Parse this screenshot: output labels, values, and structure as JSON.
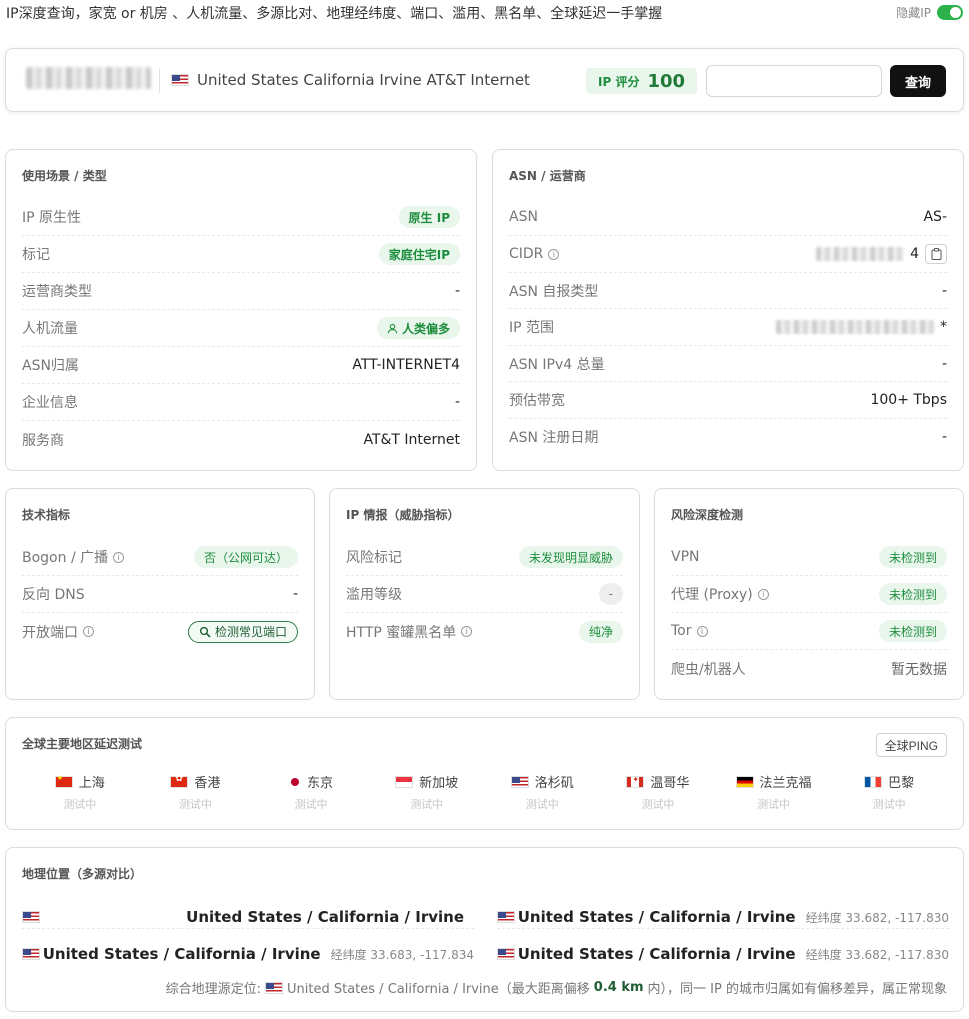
{
  "header": {
    "tagline": "IP深度查询，家宽 or 机房 、人机流量、多源比对、地理经纬度、端口、滥用、黑名单、全球延迟一手掌握",
    "hide_ip_label": "隐藏IP",
    "hide_ip_on": true
  },
  "search": {
    "location": "United States California Irvine AT&T Internet",
    "score_label": "IP 评分",
    "score_value": "100",
    "input_value": "",
    "query_button": "查询"
  },
  "usage": {
    "title": "使用场景 / 类型",
    "rows": [
      {
        "label": "IP 原生性",
        "value": "原生 IP"
      },
      {
        "label": "标记",
        "value": "家庭住宅IP"
      },
      {
        "label": "运营商类型",
        "value": "-"
      },
      {
        "label": "人机流量",
        "value": "人类偏多"
      },
      {
        "label": "ASN归属",
        "value": "ATT-INTERNET4"
      },
      {
        "label": "企业信息",
        "value": "-"
      },
      {
        "label": "服务商",
        "value": "AT&T Internet"
      }
    ]
  },
  "asn": {
    "title": "ASN / 运营商",
    "rows": [
      {
        "label": "ASN",
        "value": "AS-"
      },
      {
        "label": "CIDR",
        "value": "4"
      },
      {
        "label": "ASN 自报类型",
        "value": "-"
      },
      {
        "label": "IP 范围",
        "value": "*"
      },
      {
        "label": "ASN IPv4 总量",
        "value": "-"
      },
      {
        "label": "预估带宽",
        "value": "100+ Tbps"
      },
      {
        "label": "ASN 注册日期",
        "value": "-"
      }
    ]
  },
  "tech": {
    "title": "技术指标",
    "rows": [
      {
        "label": "Bogon / 广播",
        "value": "否（公网可达）"
      },
      {
        "label": "反向 DNS",
        "value": "-"
      },
      {
        "label": "开放端口",
        "value": "检测常见端口"
      }
    ]
  },
  "threat": {
    "title": "IP 情报（威胁指标）",
    "rows": [
      {
        "label": "风险标记",
        "value": "未发现明显威胁"
      },
      {
        "label": "滥用等级",
        "value": "-"
      },
      {
        "label": "HTTP 蜜罐黑名单",
        "value": "纯净"
      }
    ]
  },
  "risk": {
    "title": "风险深度检测",
    "rows": [
      {
        "label": "VPN",
        "value": "未检测到"
      },
      {
        "label": "代理 (Proxy)",
        "value": "未检测到"
      },
      {
        "label": "Tor",
        "value": "未检测到"
      },
      {
        "label": "爬虫/机器人",
        "value": "暂无数据"
      }
    ]
  },
  "latency": {
    "title": "全球主要地区延迟测试",
    "ping_button": "全球PING",
    "cities": [
      {
        "name": "上海",
        "flag": "cn",
        "status": "测试中"
      },
      {
        "name": "香港",
        "flag": "hk",
        "status": "测试中"
      },
      {
        "name": "东京",
        "flag": "jp",
        "status": "测试中"
      },
      {
        "name": "新加坡",
        "flag": "sg",
        "status": "测试中"
      },
      {
        "name": "洛杉矶",
        "flag": "us",
        "status": "测试中"
      },
      {
        "name": "温哥华",
        "flag": "ca",
        "status": "测试中"
      },
      {
        "name": "法兰克福",
        "flag": "de",
        "status": "测试中"
      },
      {
        "name": "巴黎",
        "flag": "fr",
        "status": "测试中"
      }
    ]
  },
  "geo": {
    "title": "地理位置（多源对比）",
    "sources": [
      {
        "location": "United States / California / Irvine",
        "coords": ""
      },
      {
        "location": "United States / California / Irvine",
        "coords": "经纬度 33.682, -117.830"
      },
      {
        "location": "United States / California / Irvine",
        "coords": "经纬度 33.683, -117.834"
      },
      {
        "location": "United States / California / Irvine",
        "coords": "经纬度 33.682, -117.830"
      }
    ],
    "summary_prefix": "综合地理源定位:",
    "summary_location": "United States / California / Irvine（最大距离偏移",
    "summary_distance": "0.4 km",
    "summary_suffix": "内），同一 IP 的城市归属如有偏移差异，属正常现象"
  },
  "colors": {
    "accent_green": "#1e8e3e",
    "pill_bg": "#e8f6ec",
    "toggle_green": "#2bb24c",
    "button_dark": "#111111"
  }
}
